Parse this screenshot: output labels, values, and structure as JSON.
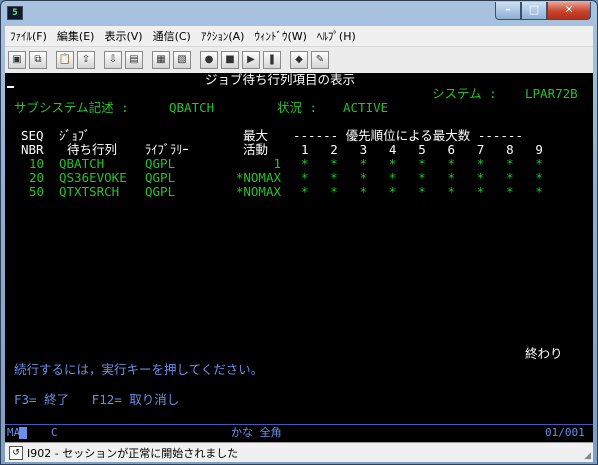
{
  "app": {
    "icon": "terminal-icon",
    "icon_text": "5"
  },
  "window_buttons": {
    "minimize": "–",
    "maximize": "□",
    "close": "✕"
  },
  "menu": [
    "ﾌｧｲﾙ(F)",
    "編集(E)",
    "表示(V)",
    "通信(C)",
    "ｱｸｼｮﾝ(A)",
    "ｳｨﾝﾄﾞｳ(W)",
    "ﾍﾙﾌﾟ(H)"
  ],
  "toolbar": [
    {
      "icon": "print-screen-icon",
      "glyph": "▣"
    },
    {
      "icon": "copy-icon",
      "glyph": "⧉"
    },
    {
      "icon": "paste-icon",
      "glyph": "📋"
    },
    {
      "icon": "send-file-icon",
      "glyph": "⇪"
    },
    {
      "icon": "receive-file-icon",
      "glyph": "⇩"
    },
    {
      "icon": "display-icon",
      "glyph": "▤"
    },
    {
      "icon": "keyboard-map-icon",
      "glyph": "▦"
    },
    {
      "icon": "macro-icon",
      "glyph": "▧"
    },
    {
      "icon": "record-macro-icon",
      "glyph": "●"
    },
    {
      "icon": "stop-macro-icon",
      "glyph": "■"
    },
    {
      "icon": "play-macro-icon",
      "glyph": "▶"
    },
    {
      "icon": "pause-macro-icon",
      "glyph": "❚"
    },
    {
      "icon": "color-map-icon",
      "glyph": "◆"
    },
    {
      "icon": "edit-icon",
      "glyph": "✎"
    }
  ],
  "screen": {
    "title": "ジョブ待ち行列項目の表示",
    "system_label": "システム :",
    "system_value": "LPAR72B",
    "subsystem_label": "サブシステム記述 :",
    "subsystem_value": "QBATCH",
    "status_label": "状況 :",
    "status_value": "ACTIVE",
    "hdr_seq": "SEQ",
    "hdr_nbr": "NBR",
    "hdr_job": "ｼﾞｮﾌﾞ",
    "hdr_queue": "待ち行列",
    "hdr_library": "ﾗｲﾌﾞﾗﾘｰ",
    "hdr_max": "最大",
    "hdr_active": "活動",
    "hdr_priority": "------ 優先順位による最大数 ------",
    "priority_numbers": [
      "1",
      "2",
      "3",
      "4",
      "5",
      "6",
      "7",
      "8",
      "9"
    ],
    "rows": [
      {
        "seq": "10",
        "queue": "QBATCH",
        "library": "QGPL",
        "max": "1",
        "stars": [
          "*",
          "*",
          "*",
          "*",
          "*",
          "*",
          "*",
          "*",
          "*"
        ]
      },
      {
        "seq": "20",
        "queue": "QS36EVOKE",
        "library": "QGPL",
        "max": "*NOMAX",
        "stars": [
          "*",
          "*",
          "*",
          "*",
          "*",
          "*",
          "*",
          "*",
          "*"
        ]
      },
      {
        "seq": "50",
        "queue": "QTXTSRCH",
        "library": "QGPL",
        "max": "*NOMAX",
        "stars": [
          "*",
          "*",
          "*",
          "*",
          "*",
          "*",
          "*",
          "*",
          "*"
        ]
      }
    ],
    "end_label": "終わり",
    "prompt": "続行するには，実行キーを押してください。",
    "fkeys": "F3= 終了   F12= 取り消し"
  },
  "status": {
    "ma": "MA",
    "c": "C",
    "mode": "かな 全角",
    "pos": "01/001"
  },
  "message": {
    "icon": "session-icon",
    "text": "I902 - セッションが正常に開始されました"
  }
}
